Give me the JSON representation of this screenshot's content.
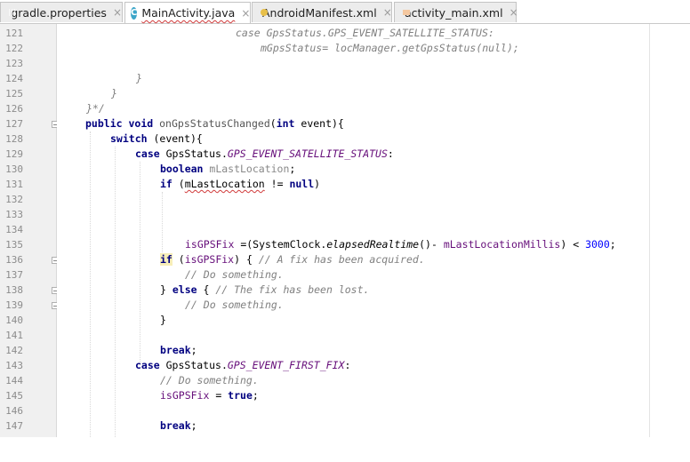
{
  "tabs": [
    {
      "label": "gradle.properties",
      "icon": "gradle-icon",
      "active": false
    },
    {
      "label": "MainActivity.java",
      "icon": "java-class-icon",
      "active": true
    },
    {
      "label": "AndroidManifest.xml",
      "icon": "manifest-icon",
      "active": false
    },
    {
      "label": "activity_main.xml",
      "icon": "layout-xml-icon",
      "active": false
    }
  ],
  "tab_close_glyph": "×",
  "class_icon_letter": "C",
  "colors": {
    "keyword": "#000080",
    "field": "#660e7a",
    "comment": "#808080",
    "number": "#0000ff",
    "error_underline": "#d13b3b",
    "gutter_bg": "#f0f0f0"
  },
  "line_numbers": [
    "121",
    "122",
    "123",
    "124",
    "125",
    "126",
    "127",
    "128",
    "129",
    "130",
    "131",
    "132",
    "133",
    "134",
    "135",
    "136",
    "137",
    "138",
    "139",
    "140",
    "141",
    "142",
    "143",
    "144",
    "145",
    "146",
    "147"
  ],
  "code": {
    "l121": {
      "a": "case GpsStatus.GPS_EVENT_SATELLITE_STATUS:"
    },
    "l122": {
      "a": "mGpsStatus= locManager.getGpsStatus(null);"
    },
    "l124": {
      "a": "}"
    },
    "l125": {
      "a": "}"
    },
    "l126": {
      "a": "}*/"
    },
    "l127": {
      "kw1": "public",
      "kw2": "void",
      "name": "onGpsStatusChanged",
      "p1": "(",
      "kw3": "int",
      "p2": " event){"
    },
    "l128": {
      "kw": "switch",
      "rest": " (event){"
    },
    "l129": {
      "kw": "case",
      "cls": " GpsStatus.",
      "fld": "GPS_EVENT_SATELLITE_STATUS",
      "end": ":"
    },
    "l130": {
      "kw": "boolean",
      "var": " mLastLocation",
      "end": ";"
    },
    "l131": {
      "kw": "if",
      "p1": " (",
      "var": "mLastLocation",
      "mid": " != ",
      "kw2": "null",
      "end": ")"
    },
    "l135": {
      "var": "isGPSFix",
      "a": " =(SystemClock.",
      "m": "elapsedRealtime",
      "b": "()- ",
      "var2": "mLastLocationMillis",
      "c": ") < ",
      "num": "3000",
      "end": ";"
    },
    "l136": {
      "kw": "if",
      "p1": " (",
      "var": "isGPSFix",
      "p2": ") { ",
      "cmt": "// A fix has been acquired."
    },
    "l137": {
      "cmt": "// Do something."
    },
    "l138": {
      "p": "} ",
      "kw": "else",
      "p2": " { ",
      "cmt": "// The fix has been lost."
    },
    "l139": {
      "cmt": "// Do something."
    },
    "l140": {
      "p": "}"
    },
    "l142": {
      "kw": "break",
      "end": ";"
    },
    "l143": {
      "kw": "case",
      "cls": " GpsStatus.",
      "fld": "GPS_EVENT_FIRST_FIX",
      "end": ":"
    },
    "l144": {
      "cmt": "// Do something."
    },
    "l145": {
      "var": "isGPSFix",
      "mid": " = ",
      "kw": "true",
      "end": ";"
    },
    "l147": {
      "kw": "break",
      "end": ";"
    }
  }
}
